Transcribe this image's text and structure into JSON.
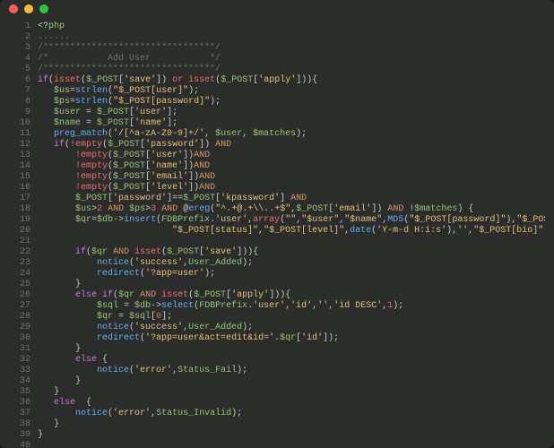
{
  "window": {
    "controls": [
      "close",
      "minimize",
      "zoom"
    ]
  },
  "code": {
    "first_line": 1,
    "last_line": 40,
    "lines": [
      [
        [
          "pun",
          "<?"
        ],
        [
          "var",
          "php"
        ]
      ],
      [
        [
          "cmt",
          "......"
        ]
      ],
      [
        [
          "cmt",
          "/********************************/"
        ]
      ],
      [
        [
          "cmt",
          "/*           Add User           */"
        ]
      ],
      [
        [
          "cmt",
          "/********************************/"
        ]
      ],
      [
        [
          "kw",
          "if"
        ],
        [
          "pun",
          "("
        ],
        [
          "kw2",
          "isset"
        ],
        [
          "pun",
          "("
        ],
        [
          "var",
          "$_POST"
        ],
        [
          "pun",
          "["
        ],
        [
          "str",
          "'save'"
        ],
        [
          "pun",
          "]) "
        ],
        [
          "kw2",
          "or"
        ],
        [
          "pun",
          " "
        ],
        [
          "kw2",
          "isset"
        ],
        [
          "pun",
          "("
        ],
        [
          "var",
          "$_POST"
        ],
        [
          "pun",
          "["
        ],
        [
          "str",
          "'apply'"
        ],
        [
          "pun",
          "])){"
        ]
      ],
      [
        [
          "pun",
          "   "
        ],
        [
          "var",
          "$us"
        ],
        [
          "pun",
          "="
        ],
        [
          "fn",
          "strlen"
        ],
        [
          "pun",
          "("
        ],
        [
          "str",
          "\"$_POST[user]\""
        ],
        [
          "pun",
          ");"
        ]
      ],
      [
        [
          "pun",
          "   "
        ],
        [
          "var",
          "$ps"
        ],
        [
          "pun",
          "="
        ],
        [
          "fn",
          "strlen"
        ],
        [
          "pun",
          "("
        ],
        [
          "str",
          "\"$_POST[password]\""
        ],
        [
          "pun",
          ");"
        ]
      ],
      [
        [
          "pun",
          "   "
        ],
        [
          "var",
          "$user"
        ],
        [
          "pun",
          " = "
        ],
        [
          "var",
          "$_POST"
        ],
        [
          "pun",
          "["
        ],
        [
          "str",
          "'user'"
        ],
        [
          "pun",
          "];"
        ]
      ],
      [
        [
          "pun",
          "   "
        ],
        [
          "var",
          "$name"
        ],
        [
          "pun",
          " = "
        ],
        [
          "var",
          "$_POST"
        ],
        [
          "pun",
          "["
        ],
        [
          "str",
          "'name'"
        ],
        [
          "pun",
          "];"
        ]
      ],
      [
        [
          "pun",
          "   "
        ],
        [
          "fn",
          "preg_match"
        ],
        [
          "pun",
          "("
        ],
        [
          "str",
          "'/[^a-zA-Z0-9]+/'"
        ],
        [
          "pun",
          ", "
        ],
        [
          "var",
          "$user"
        ],
        [
          "pun",
          ", "
        ],
        [
          "var",
          "$matches"
        ],
        [
          "pun",
          ");"
        ]
      ],
      [
        [
          "pun",
          "   "
        ],
        [
          "kw",
          "if"
        ],
        [
          "pun",
          "("
        ],
        [
          "kw2",
          "!empty"
        ],
        [
          "pun",
          "("
        ],
        [
          "var",
          "$_POST"
        ],
        [
          "pun",
          "["
        ],
        [
          "str",
          "'password'"
        ],
        [
          "pun",
          "]) "
        ],
        [
          "op",
          "AND"
        ]
      ],
      [
        [
          "pun",
          "       "
        ],
        [
          "kw2",
          "!empty"
        ],
        [
          "pun",
          "("
        ],
        [
          "var",
          "$_POST"
        ],
        [
          "pun",
          "["
        ],
        [
          "str",
          "'user'"
        ],
        [
          "pun",
          "])"
        ],
        [
          "op",
          "AND"
        ]
      ],
      [
        [
          "pun",
          "       "
        ],
        [
          "kw2",
          "!empty"
        ],
        [
          "pun",
          "("
        ],
        [
          "var",
          "$_POST"
        ],
        [
          "pun",
          "["
        ],
        [
          "str",
          "'name'"
        ],
        [
          "pun",
          "])"
        ],
        [
          "op",
          "AND"
        ]
      ],
      [
        [
          "pun",
          "       "
        ],
        [
          "kw2",
          "!empty"
        ],
        [
          "pun",
          "("
        ],
        [
          "var",
          "$_POST"
        ],
        [
          "pun",
          "["
        ],
        [
          "str",
          "'email'"
        ],
        [
          "pun",
          "])"
        ],
        [
          "op",
          "AND"
        ]
      ],
      [
        [
          "pun",
          "       "
        ],
        [
          "kw2",
          "!empty"
        ],
        [
          "pun",
          "("
        ],
        [
          "var",
          "$_POST"
        ],
        [
          "pun",
          "["
        ],
        [
          "str",
          "'level'"
        ],
        [
          "pun",
          "])"
        ],
        [
          "op",
          "AND"
        ]
      ],
      [
        [
          "pun",
          "       "
        ],
        [
          "var",
          "$_POST"
        ],
        [
          "pun",
          "["
        ],
        [
          "str",
          "'password'"
        ],
        [
          "pun",
          "]=="
        ],
        [
          "var",
          "$_POST"
        ],
        [
          "pun",
          "["
        ],
        [
          "str",
          "'kpassword'"
        ],
        [
          "pun",
          "] "
        ],
        [
          "op",
          "AND"
        ]
      ],
      [
        [
          "pun",
          "       "
        ],
        [
          "var",
          "$us"
        ],
        [
          "pun",
          ">"
        ],
        [
          "num",
          "2"
        ],
        [
          "pun",
          " "
        ],
        [
          "op",
          "AND"
        ],
        [
          "pun",
          " "
        ],
        [
          "var",
          "$ps"
        ],
        [
          "pun",
          ">"
        ],
        [
          "num",
          "3"
        ],
        [
          "pun",
          " "
        ],
        [
          "op",
          "AND"
        ],
        [
          "pun",
          " @"
        ],
        [
          "fn",
          "ereg"
        ],
        [
          "pun",
          "("
        ],
        [
          "str",
          "\"^.+@.+\\\\..+$\""
        ],
        [
          "pun",
          ","
        ],
        [
          "var",
          "$_POST"
        ],
        [
          "pun",
          "["
        ],
        [
          "str",
          "'email'"
        ],
        [
          "pun",
          "]) "
        ],
        [
          "op",
          "AND"
        ],
        [
          "pun",
          " !"
        ],
        [
          "var",
          "$matches"
        ],
        [
          "pun",
          ") {"
        ]
      ],
      [
        [
          "pun",
          "       "
        ],
        [
          "var",
          "$qr"
        ],
        [
          "pun",
          "="
        ],
        [
          "var",
          "$db"
        ],
        [
          "pun",
          "->"
        ],
        [
          "fn",
          "insert"
        ],
        [
          "pun",
          "("
        ],
        [
          "var",
          "FDBPrefix"
        ],
        [
          "pun",
          "."
        ],
        [
          "str",
          "'user'"
        ],
        [
          "pun",
          ","
        ],
        [
          "kw2",
          "array"
        ],
        [
          "pun",
          "("
        ],
        [
          "str",
          "\"\""
        ],
        [
          "pun",
          ","
        ],
        [
          "str",
          "\"$user\""
        ],
        [
          "pun",
          ","
        ],
        [
          "str",
          "\"$name\""
        ],
        [
          "pun",
          ","
        ],
        [
          "fn",
          "MD5"
        ],
        [
          "pun",
          "("
        ],
        [
          "str",
          "\"$_POST[password]\""
        ],
        [
          "pun",
          "),"
        ],
        [
          "str",
          "\"$_POST[email]\""
        ],
        [
          "pun",
          ","
        ]
      ],
      [
        [
          "pun",
          "                         "
        ],
        [
          "str",
          "\"$_POST[status]\""
        ],
        [
          "pun",
          ","
        ],
        [
          "str",
          "\"$_POST[level]\""
        ],
        [
          "pun",
          ","
        ],
        [
          "fn",
          "date"
        ],
        [
          "pun",
          "("
        ],
        [
          "str",
          "'Y-m-d H:i:s'"
        ],
        [
          "pun",
          "),"
        ],
        [
          "str",
          "''"
        ],
        [
          "pun",
          ","
        ],
        [
          "str",
          "\"$_POST[bio]\""
        ],
        [
          "pun",
          "));"
        ]
      ],
      [
        [
          "pun",
          ""
        ]
      ],
      [
        [
          "pun",
          "       "
        ],
        [
          "kw",
          "if"
        ],
        [
          "pun",
          "("
        ],
        [
          "var",
          "$qr"
        ],
        [
          "pun",
          " "
        ],
        [
          "op",
          "AND"
        ],
        [
          "pun",
          " "
        ],
        [
          "kw2",
          "isset"
        ],
        [
          "pun",
          "("
        ],
        [
          "var",
          "$_POST"
        ],
        [
          "pun",
          "["
        ],
        [
          "str",
          "'save'"
        ],
        [
          "pun",
          "])){"
        ]
      ],
      [
        [
          "pun",
          "           "
        ],
        [
          "fn",
          "notice"
        ],
        [
          "pun",
          "("
        ],
        [
          "str",
          "'success'"
        ],
        [
          "pun",
          ","
        ],
        [
          "var",
          "User_Added"
        ],
        [
          "pun",
          ");"
        ]
      ],
      [
        [
          "pun",
          "           "
        ],
        [
          "fn",
          "redirect"
        ],
        [
          "pun",
          "("
        ],
        [
          "str",
          "'?app=user'"
        ],
        [
          "pun",
          ");"
        ]
      ],
      [
        [
          "pun",
          "       }"
        ]
      ],
      [
        [
          "pun",
          "       "
        ],
        [
          "kw",
          "else if"
        ],
        [
          "pun",
          "("
        ],
        [
          "var",
          "$qr"
        ],
        [
          "pun",
          " "
        ],
        [
          "op",
          "AND"
        ],
        [
          "pun",
          " "
        ],
        [
          "kw2",
          "isset"
        ],
        [
          "pun",
          "("
        ],
        [
          "var",
          "$_POST"
        ],
        [
          "pun",
          "["
        ],
        [
          "str",
          "'apply'"
        ],
        [
          "pun",
          "])){"
        ]
      ],
      [
        [
          "pun",
          "           "
        ],
        [
          "var",
          "$sql"
        ],
        [
          "pun",
          " = "
        ],
        [
          "var",
          "$db"
        ],
        [
          "pun",
          "->"
        ],
        [
          "fn",
          "select"
        ],
        [
          "pun",
          "("
        ],
        [
          "var",
          "FDBPrefix"
        ],
        [
          "pun",
          "."
        ],
        [
          "str",
          "'user'"
        ],
        [
          "pun",
          ","
        ],
        [
          "str",
          "'id'"
        ],
        [
          "pun",
          ","
        ],
        [
          "str",
          "''"
        ],
        [
          "pun",
          ","
        ],
        [
          "str",
          "'id DESC'"
        ],
        [
          "pun",
          ","
        ],
        [
          "num",
          "1"
        ],
        [
          "pun",
          ");"
        ]
      ],
      [
        [
          "pun",
          "           "
        ],
        [
          "var",
          "$qr"
        ],
        [
          "pun",
          " = "
        ],
        [
          "var",
          "$sql"
        ],
        [
          "pun",
          "["
        ],
        [
          "num",
          "0"
        ],
        [
          "pun",
          "];"
        ]
      ],
      [
        [
          "pun",
          "           "
        ],
        [
          "fn",
          "notice"
        ],
        [
          "pun",
          "("
        ],
        [
          "str",
          "'success'"
        ],
        [
          "pun",
          ","
        ],
        [
          "var",
          "User_Added"
        ],
        [
          "pun",
          ");"
        ]
      ],
      [
        [
          "pun",
          "           "
        ],
        [
          "fn",
          "redirect"
        ],
        [
          "pun",
          "("
        ],
        [
          "str",
          "'?app=user&act=edit&id='"
        ],
        [
          "pun",
          "."
        ],
        [
          "var",
          "$qr"
        ],
        [
          "pun",
          "["
        ],
        [
          "str",
          "'id'"
        ],
        [
          "pun",
          "]);"
        ]
      ],
      [
        [
          "pun",
          "       }"
        ]
      ],
      [
        [
          "pun",
          "       "
        ],
        [
          "kw",
          "else"
        ],
        [
          "pun",
          " {"
        ]
      ],
      [
        [
          "pun",
          "           "
        ],
        [
          "fn",
          "notice"
        ],
        [
          "pun",
          "("
        ],
        [
          "str",
          "'error'"
        ],
        [
          "pun",
          ","
        ],
        [
          "var",
          "Status_Fail"
        ],
        [
          "pun",
          ");"
        ]
      ],
      [
        [
          "pun",
          "       }"
        ]
      ],
      [
        [
          "pun",
          "   }"
        ]
      ],
      [
        [
          "pun",
          "   "
        ],
        [
          "kw",
          "else"
        ],
        [
          "pun",
          "  {"
        ]
      ],
      [
        [
          "pun",
          "       "
        ],
        [
          "fn",
          "notice"
        ],
        [
          "pun",
          "("
        ],
        [
          "str",
          "'error'"
        ],
        [
          "pun",
          ","
        ],
        [
          "var",
          "Status_Invalid"
        ],
        [
          "pun",
          ");"
        ]
      ],
      [
        [
          "pun",
          "   }"
        ]
      ],
      [
        [
          "pun",
          "}"
        ]
      ],
      [
        [
          "cmt",
          "......"
        ]
      ]
    ]
  }
}
